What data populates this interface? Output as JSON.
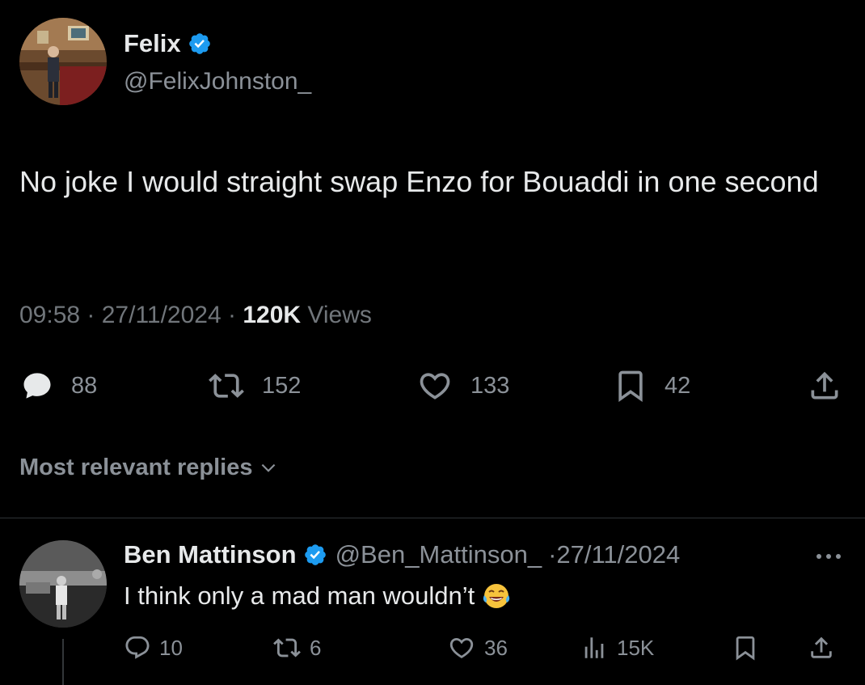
{
  "tweet": {
    "author_name": "Felix",
    "author_handle": "@FelixJohnston_",
    "text": "No joke I would straight swap Enzo for Bouaddi in one second",
    "time": "09:58",
    "date": "27/11/2024",
    "views_count": "120K",
    "views_label": "Views",
    "replies": "88",
    "reposts": "152",
    "likes": "133",
    "bookmarks": "42"
  },
  "replies_section": {
    "label": "Most relevant replies"
  },
  "reply": {
    "author_name": "Ben Mattinson",
    "author_handle": "@Ben_Mattinson_",
    "date": "·27/11/2024",
    "text": "I think only a mad man wouldn’t",
    "replies": "10",
    "reposts": "6",
    "likes": "36",
    "views": "15K"
  },
  "icons": {
    "verified": "verified-badge-icon",
    "reply": "reply-icon",
    "repost": "repost-icon",
    "like": "like-icon",
    "bookmark": "bookmark-icon",
    "share": "share-icon",
    "views": "views-icon",
    "more": "more-icon",
    "chevron": "chevron-down-icon",
    "emoji": "tears-of-joy-emoji-icon"
  },
  "colors": {
    "background": "#000000",
    "primary_text": "#e7e9ea",
    "secondary_text": "#71767b",
    "verified_blue": "#1d9bf0",
    "divider": "#2f3336"
  }
}
